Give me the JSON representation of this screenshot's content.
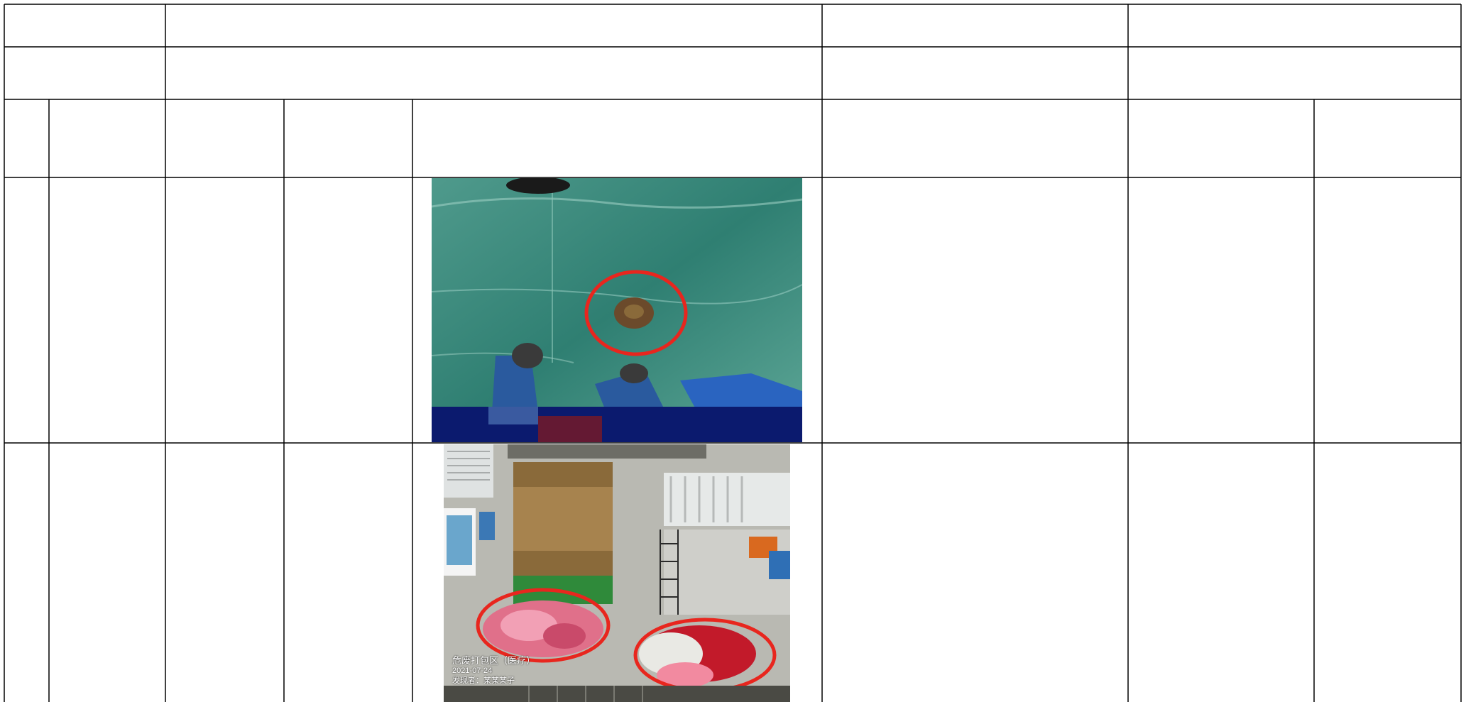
{
  "document": {
    "photo_1": {
      "subject": "floor surface damage marked with red circle"
    },
    "photo_2": {
      "subject": "waste bags marked with red circles",
      "caption_line_1": "危废打包区（医疗）",
      "caption_line_2": "2021-07-24",
      "caption_line_3": "发现者：某某某子"
    }
  },
  "colors": {
    "grid_line": "#000000",
    "annotation_circle": "#e8261e",
    "floor_green": "#2f7f72",
    "wall_rust": "#8a6a3a"
  }
}
